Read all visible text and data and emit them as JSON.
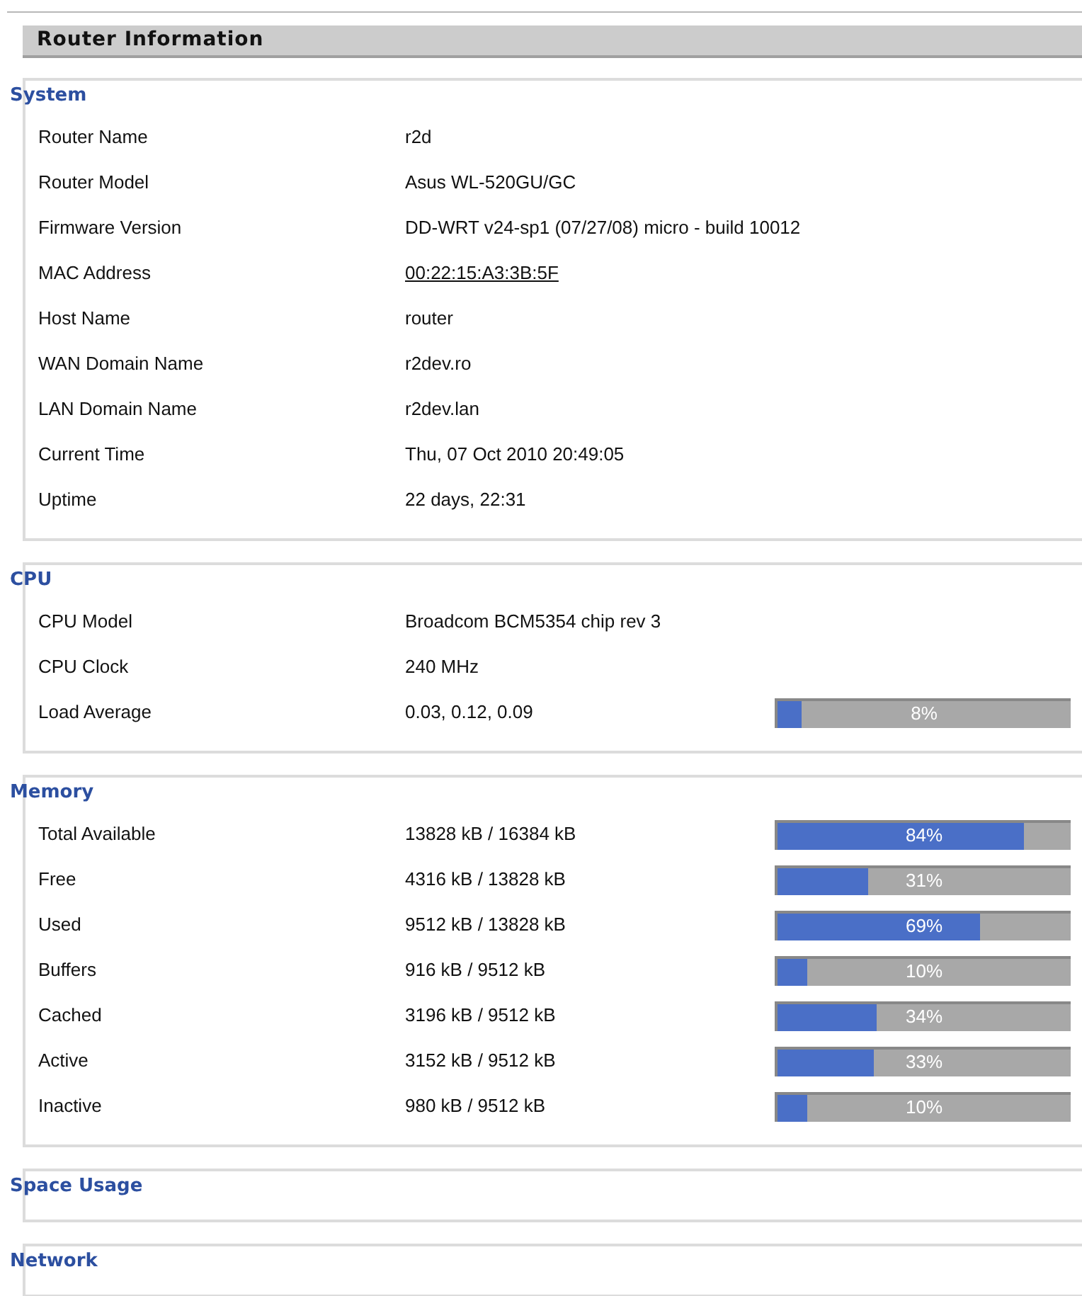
{
  "header": {
    "title": "Router Information"
  },
  "sections": [
    {
      "title": "System",
      "rows": [
        {
          "label": "Router Name",
          "value": "r2d"
        },
        {
          "label": "Router Model",
          "value": "Asus WL-520GU/GC"
        },
        {
          "label": "Firmware Version",
          "value": "DD-WRT v24-sp1 (07/27/08) micro - build 10012"
        },
        {
          "label": "MAC Address",
          "value": "00:22:15:A3:3B:5F",
          "kind": "link"
        },
        {
          "label": "Host Name",
          "value": "router"
        },
        {
          "label": "WAN Domain Name",
          "value": "r2dev.ro"
        },
        {
          "label": "LAN Domain Name",
          "value": "r2dev.lan"
        },
        {
          "label": "Current Time",
          "value": "Thu, 07 Oct 2010 20:49:05"
        },
        {
          "label": "Uptime",
          "value": "22 days, 22:31"
        }
      ]
    },
    {
      "title": "CPU",
      "rows": [
        {
          "label": "CPU Model",
          "value": "Broadcom BCM5354 chip rev 3"
        },
        {
          "label": "CPU Clock",
          "value": "240 MHz"
        },
        {
          "label": "Load Average",
          "value": "0.03, 0.12, 0.09",
          "meter": {
            "level": 0.08,
            "reading": "8%"
          }
        }
      ]
    },
    {
      "title": "Memory",
      "rows": [
        {
          "label": "Total Available",
          "value": "13828 kB / 16384 kB",
          "meter": {
            "level": 0.84,
            "reading": "84%"
          }
        },
        {
          "label": "Free",
          "value": "4316 kB / 13828 kB",
          "meter": {
            "level": 0.31,
            "reading": "31%"
          }
        },
        {
          "label": "Used",
          "value": "9512 kB / 13828 kB",
          "meter": {
            "level": 0.69,
            "reading": "69%"
          }
        },
        {
          "label": "Buffers",
          "value": "916 kB / 9512 kB",
          "meter": {
            "level": 0.1,
            "reading": "10%"
          }
        },
        {
          "label": "Cached",
          "value": "3196 kB / 9512 kB",
          "meter": {
            "level": 0.34,
            "reading": "34%"
          }
        },
        {
          "label": "Active",
          "value": "3152 kB / 9512 kB",
          "meter": {
            "level": 0.33,
            "reading": "33%"
          }
        },
        {
          "label": "Inactive",
          "value": "980 kB / 9512 kB",
          "meter": {
            "level": 0.1,
            "reading": "10%"
          }
        }
      ]
    },
    {
      "title": "Space Usage"
    },
    {
      "title": "Network"
    }
  ]
}
